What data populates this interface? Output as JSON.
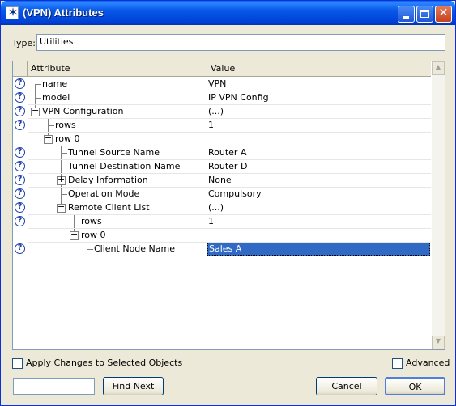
{
  "window": {
    "title": "(VPN) Attributes"
  },
  "type": {
    "label": "Type:",
    "value": "Utilities"
  },
  "grid": {
    "columns": [
      "Attribute",
      "Value"
    ],
    "rows": [
      {
        "name": "name",
        "value": "VPN"
      },
      {
        "name": "model",
        "value": "IP VPN Config"
      },
      {
        "name": "VPN Configuration",
        "value": "(...)"
      },
      {
        "name": "rows",
        "value": "1"
      },
      {
        "name": "row 0",
        "value": ""
      },
      {
        "name": "Tunnel Source Name",
        "value": "Router A"
      },
      {
        "name": "Tunnel Destination Name",
        "value": "Router D"
      },
      {
        "name": "Delay Information",
        "value": "None"
      },
      {
        "name": "Operation Mode",
        "value": "Compulsory"
      },
      {
        "name": "Remote Client List",
        "value": "(...)"
      },
      {
        "name": "rows",
        "value": "1"
      },
      {
        "name": "row 0",
        "value": ""
      },
      {
        "name": "Client Node Name",
        "value": "Sales A"
      }
    ]
  },
  "options": {
    "apply_changes": "Apply Changes to Selected Objects",
    "advanced": "Advanced"
  },
  "buttons": {
    "find_next": "Find Next",
    "cancel": "Cancel",
    "ok": "OK"
  },
  "find": {
    "value": ""
  },
  "icons": {
    "help": "help-icon",
    "expand": "plus",
    "collapse": "minus"
  }
}
